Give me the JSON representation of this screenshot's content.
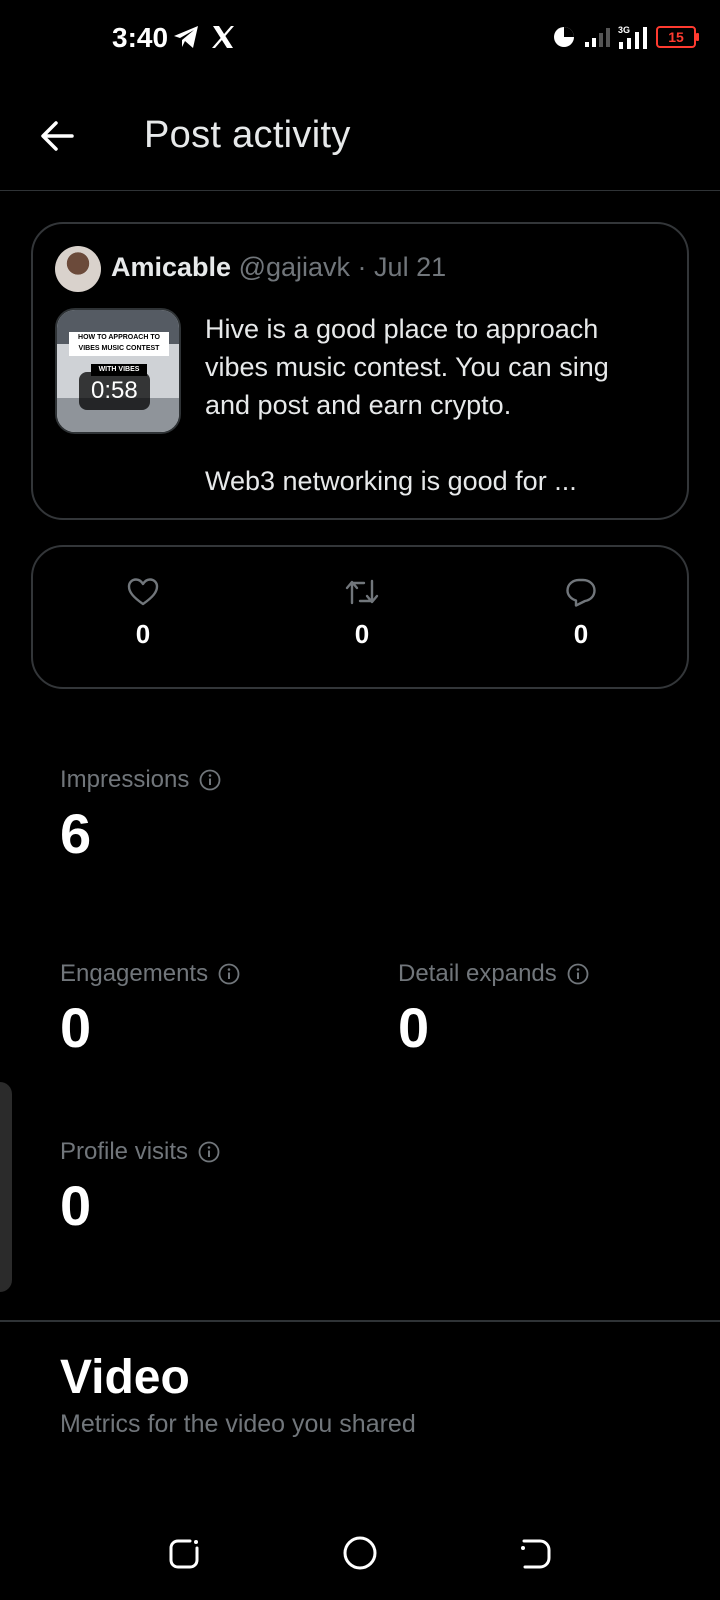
{
  "status_bar": {
    "time": "3:40",
    "battery": "15",
    "network": "3G"
  },
  "header": {
    "title": "Post activity"
  },
  "post": {
    "author": "Amicable",
    "handle": "@gajiavk",
    "separator": " · ",
    "date": "Jul 21",
    "text": "Hive is a good place to approach vibes music contest. You can sing and post and earn crypto.\n\nWeb3 networking is good for ...",
    "thumbnail": {
      "banner": "HOW TO APPROACH TO VIBES MUSIC CONTEST",
      "tag": "WITH VIBES",
      "duration": "0:58"
    }
  },
  "engagement": {
    "likes": "0",
    "reposts": "0",
    "replies": "0"
  },
  "metrics": {
    "impressions": {
      "label": "Impressions",
      "value": "6"
    },
    "engagements": {
      "label": "Engagements",
      "value": "0"
    },
    "detail_expands": {
      "label": "Detail expands",
      "value": "0"
    },
    "profile_visits": {
      "label": "Profile visits",
      "value": "0"
    }
  },
  "video_section": {
    "title": "Video",
    "subtitle": "Metrics for the video you shared"
  },
  "colors": {
    "background": "#000000",
    "text": "#e7e9ea",
    "muted": "#71767b",
    "border": "#333639",
    "battery_alert": "#ff3b30"
  }
}
